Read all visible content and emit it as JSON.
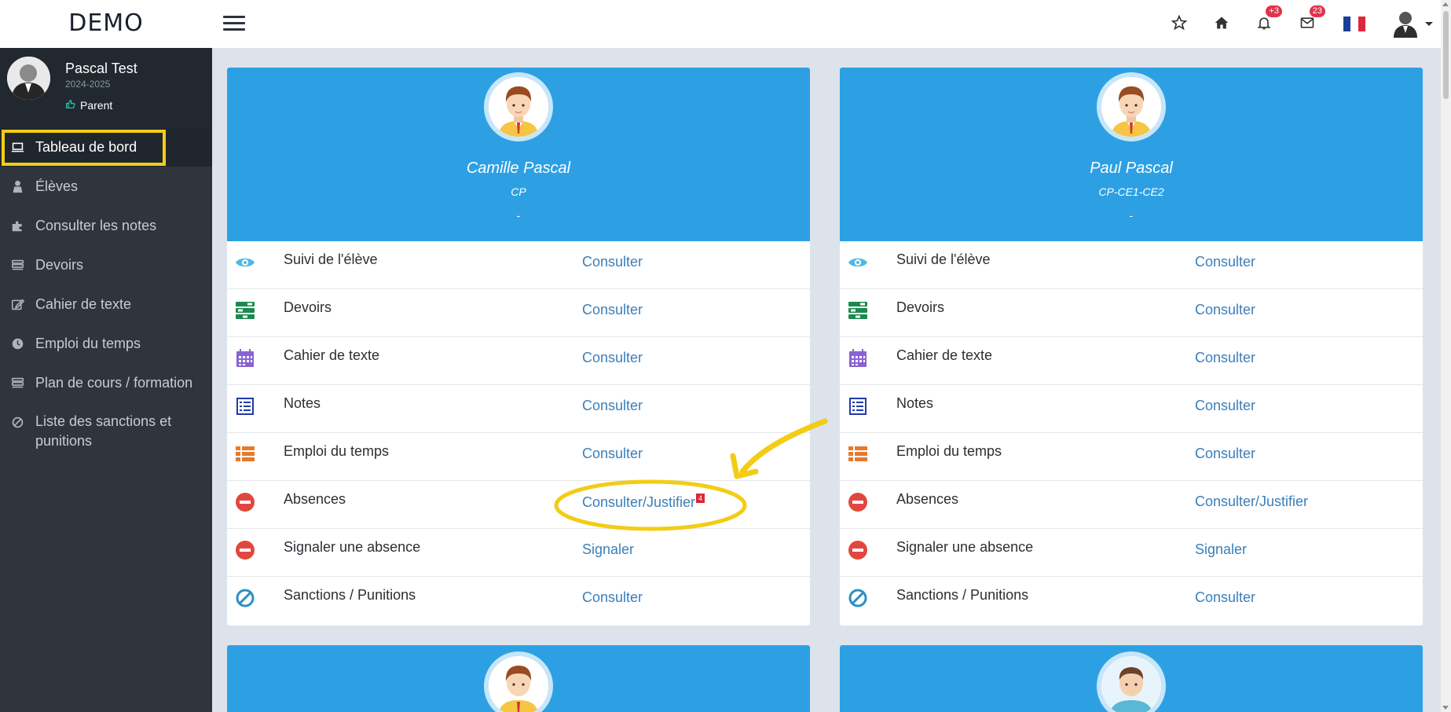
{
  "app": {
    "brand": "DEMO"
  },
  "topbar": {
    "notifications_badge": "+3",
    "messages_badge": "23",
    "language_flag": [
      "#1a3f97",
      "#ffffff",
      "#e0263a"
    ]
  },
  "profile": {
    "name": "Pascal Test",
    "year": "2024-2025",
    "role": "Parent"
  },
  "sidebar": {
    "items": [
      {
        "label": "Tableau de bord",
        "icon": "laptop-icon"
      },
      {
        "label": "Élèves",
        "icon": "user-icon"
      },
      {
        "label": "Consulter les notes",
        "icon": "puzzle-icon"
      },
      {
        "label": "Devoirs",
        "icon": "stack-icon"
      },
      {
        "label": "Cahier de texte",
        "icon": "edit-icon"
      },
      {
        "label": "Emploi du temps",
        "icon": "clock-icon"
      },
      {
        "label": "Plan de cours / formation",
        "icon": "stack-icon"
      },
      {
        "label": "Liste des sanctions et punitions",
        "icon": "ban-icon"
      }
    ]
  },
  "students": [
    {
      "name": "Camille Pascal",
      "class": "CP",
      "extra": "-",
      "rows": [
        {
          "label": "Suivi de l'élève",
          "link": "Consulter",
          "icon": "eye-icon"
        },
        {
          "label": "Devoirs",
          "link": "Consulter",
          "icon": "tasks-icon"
        },
        {
          "label": "Cahier de texte",
          "link": "Consulter",
          "icon": "calendar-icon"
        },
        {
          "label": "Notes",
          "link": "Consulter",
          "icon": "list-icon"
        },
        {
          "label": "Emploi du temps",
          "link": "Consulter",
          "icon": "th-list-icon"
        },
        {
          "label": "Absences",
          "link": "Consulter/Justifier",
          "badge": "4",
          "icon": "minus-circle-icon"
        },
        {
          "label": "Signaler une absence",
          "link": "Signaler",
          "icon": "minus-circle-icon"
        },
        {
          "label": "Sanctions / Punitions",
          "link": "Consulter",
          "icon": "ban-icon"
        }
      ]
    },
    {
      "name": "Paul Pascal",
      "class": "CP-CE1-CE2",
      "extra": "-",
      "rows": [
        {
          "label": "Suivi de l'élève",
          "link": "Consulter",
          "icon": "eye-icon"
        },
        {
          "label": "Devoirs",
          "link": "Consulter",
          "icon": "tasks-icon"
        },
        {
          "label": "Cahier de texte",
          "link": "Consulter",
          "icon": "calendar-icon"
        },
        {
          "label": "Notes",
          "link": "Consulter",
          "icon": "list-icon"
        },
        {
          "label": "Emploi du temps",
          "link": "Consulter",
          "icon": "th-list-icon"
        },
        {
          "label": "Absences",
          "link": "Consulter/Justifier",
          "icon": "minus-circle-icon"
        },
        {
          "label": "Signaler une absence",
          "link": "Signaler",
          "icon": "minus-circle-icon"
        },
        {
          "label": "Sanctions / Punitions",
          "link": "Consulter",
          "icon": "ban-icon"
        }
      ]
    }
  ],
  "colors": {
    "card_header": "#2da0e4",
    "sidebar_bg": "#2f353d",
    "link": "#3a7fb8",
    "highlight": "#f3cc16"
  }
}
